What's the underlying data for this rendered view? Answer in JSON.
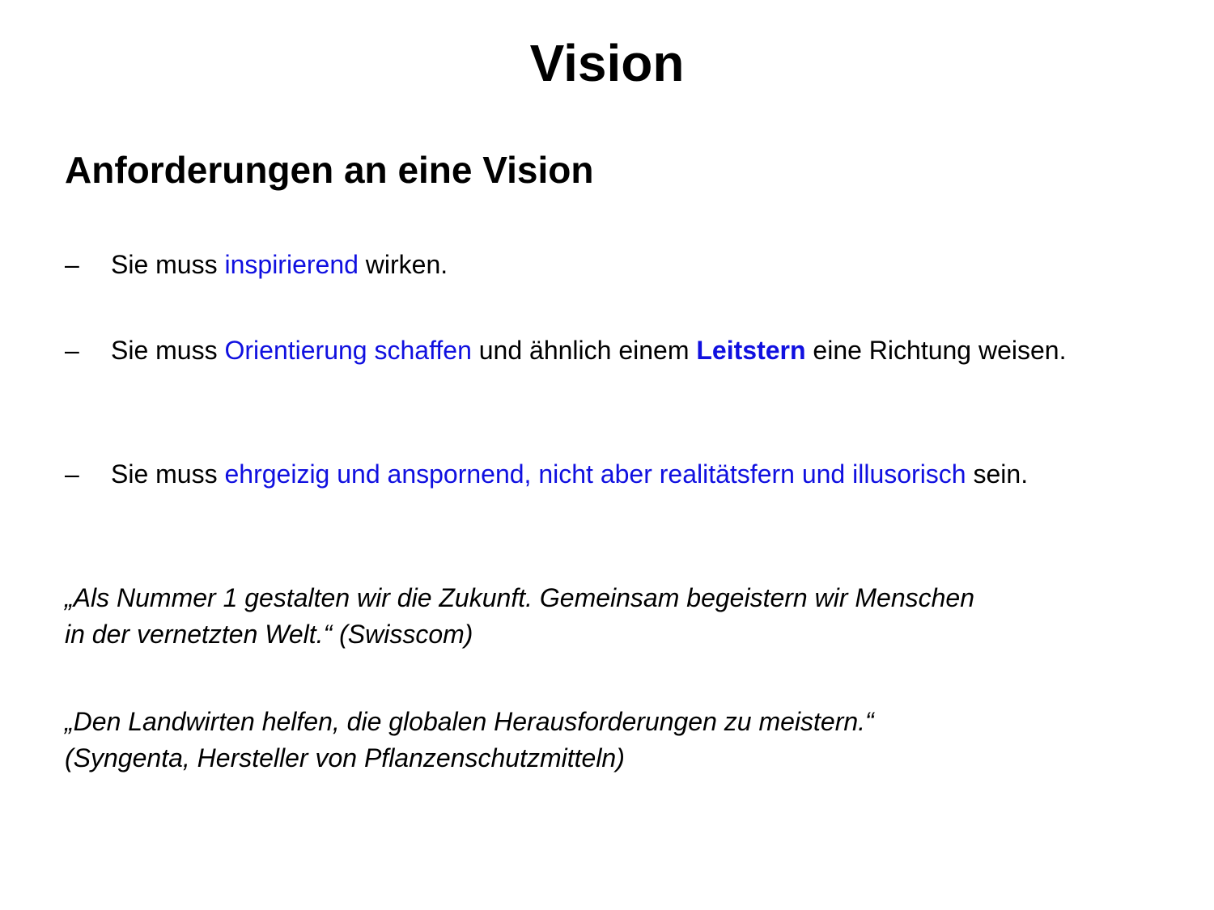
{
  "title": "Vision",
  "subtitle": "Anforderungen an eine Vision",
  "bullet_marker": "–",
  "bullets": [
    {
      "pre": "Sie muss ",
      "hl1": "inspirierend",
      "post": " wirken."
    },
    {
      "pre": "Sie muss ",
      "hl1": "Orientierung schaffen",
      "mid": " und ähnlich einem ",
      "hl2": "Leitstern",
      "post": " eine Richtung weisen."
    },
    {
      "pre": "Sie muss ",
      "hl1": "ehrgeizig und anspornend, nicht aber realitätsfern und illusorisch",
      "post": " sein."
    }
  ],
  "quotes": [
    {
      "line1": "„Als Nummer 1 gestalten wir die Zukunft. Gemeinsam begeistern wir Menschen",
      "line2": "in der vernetzten Welt.“ (Swisscom)"
    },
    {
      "line1": "„Den Landwirten helfen, die globalen Herausforderungen zu meistern.“",
      "line2": "(Syngenta, Hersteller von Pflanzenschutzmitteln)"
    }
  ],
  "colors": {
    "text": "#000000",
    "highlight": "#1010e0",
    "background": "#ffffff"
  }
}
